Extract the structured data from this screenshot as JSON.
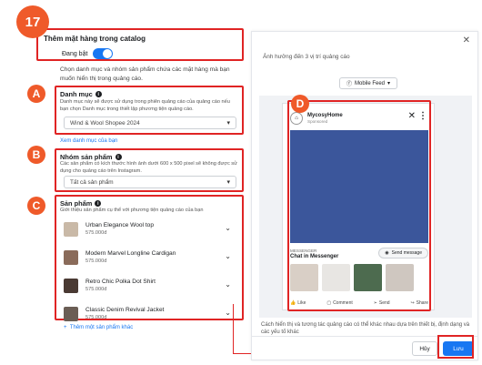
{
  "step_number": "17",
  "colors": {
    "accent": "#1877f2",
    "highlight": "#e02424",
    "badge": "#ef5a2a",
    "media": "#3b569b"
  },
  "catalog": {
    "title": "Thêm mặt hàng trong catalog",
    "toggle_label": "Đang bật",
    "toggle_on": true,
    "intro": "Chọn danh mục và nhóm sản phẩm chứa các mặt hàng mà bạn muốn hiển thị trong quảng cáo."
  },
  "section_a": {
    "letter": "A",
    "title": "Danh mục",
    "desc": "Danh mục này sẽ được sử dụng trong phiên quảng cáo của quảng cáo nếu bạn chọn Danh mục trong thiết lập phương tiện quảng cáo.",
    "select_value": "Wind & Wool Shopee 2024",
    "link": "Xem danh mục của bạn"
  },
  "section_b": {
    "letter": "B",
    "title": "Nhóm sản phẩm",
    "desc": "Các sản phẩm có kích thước hình ảnh dưới 600 x 500 pixel sẽ không được sử dụng cho quảng cáo trên Instagram.",
    "select_value": "Tất cả sản phẩm"
  },
  "section_c": {
    "letter": "C",
    "title": "Sản phẩm",
    "desc": "Giới thiệu sản phẩm cụ thể với phương tiện quảng cáo của bạn",
    "products": [
      {
        "name": "Urban Elegance Wool top",
        "price": "575.000đ",
        "color": "#c9b9a7"
      },
      {
        "name": "Modern Marvel Longline Cardigan",
        "price": "575.000đ",
        "color": "#8a6b5a"
      },
      {
        "name": "Retro Chic Polka Dot Shirt",
        "price": "575.000đ",
        "color": "#4a3a33"
      },
      {
        "name": "Classic Denim Revival Jacket",
        "price": "575.000đ",
        "color": "#6b5e55"
      }
    ],
    "add_more": "Thêm một sản phẩm khác"
  },
  "preview": {
    "letter": "D",
    "caption": "Ảnh hưởng đến 3 vị trí quảng cáo",
    "feed_select": "Mobile Feed",
    "page_name": "MycosyHome",
    "sponsored": "Sponsored",
    "messenger_label": "MESSENGER",
    "chat_label": "Chat in Messenger",
    "send_button": "Send message",
    "carousel_colors": [
      "#d9cfc6",
      "#e8e6e3",
      "#4d6b4f",
      "#cfc7c0",
      "#9a8f88"
    ],
    "actions": [
      "Like",
      "Comment",
      "Send",
      "Share"
    ],
    "note": "Cách hiển thị và tương tác quảng cáo có thể khác nhau dựa trên thiết bị, định dạng và các yếu tố khác"
  },
  "footer": {
    "cancel": "Hủy",
    "save": "Lưu"
  }
}
